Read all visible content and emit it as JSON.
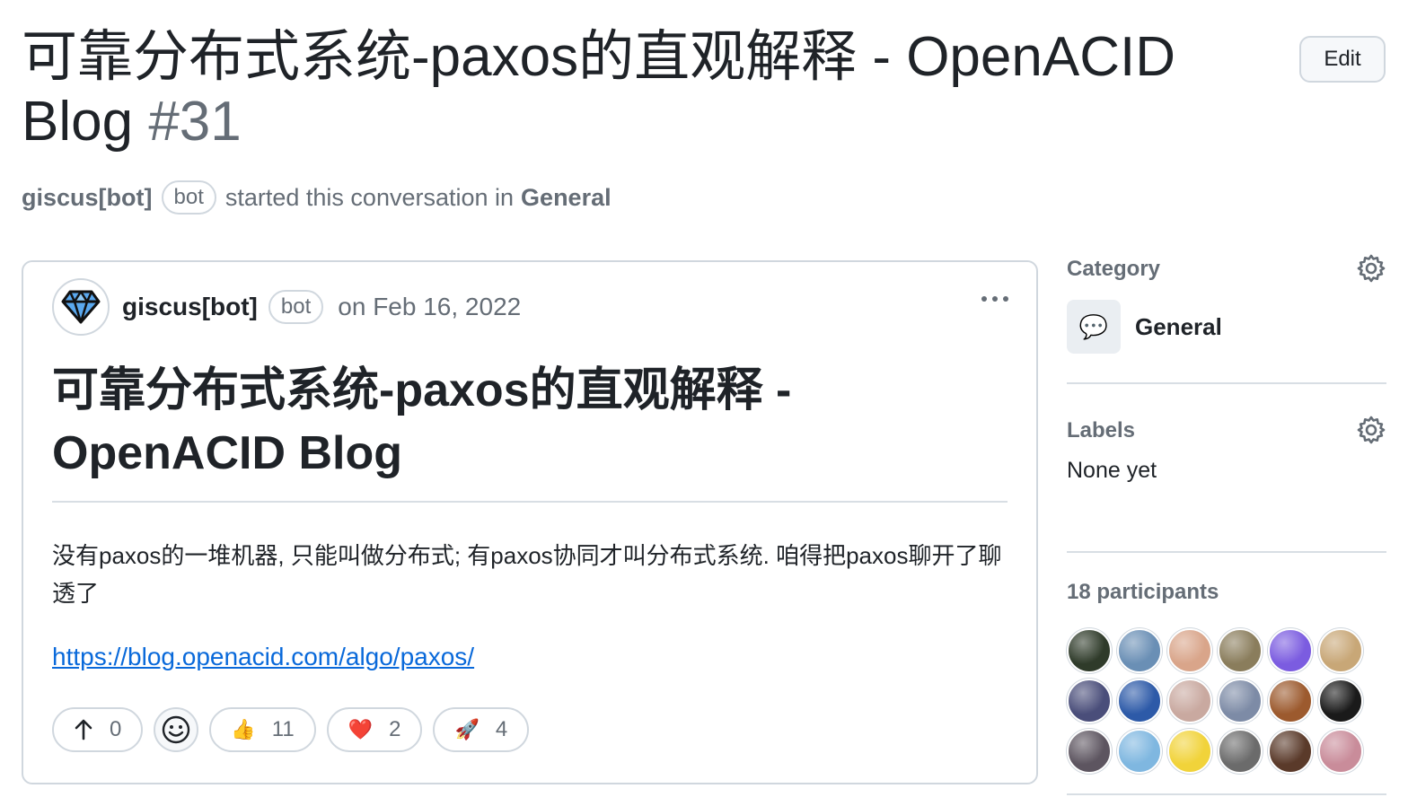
{
  "header": {
    "title": "可靠分布式系统-paxos的直观解释 - OpenACID Blog",
    "number": "#31",
    "edit_label": "Edit"
  },
  "meta": {
    "author": "giscus[bot]",
    "badge": "bot",
    "text": "started this conversation in",
    "category": "General"
  },
  "post": {
    "author": "giscus[bot]",
    "badge": "bot",
    "date": "on Feb 16, 2022",
    "title": "可靠分布式系统-paxos的直观解释 - OpenACID Blog",
    "body": "没有paxos的一堆机器, 只能叫做分布式; 有paxos协同才叫分布式系统. 咱得把paxos聊开了聊透了",
    "link": "https://blog.openacid.com/algo/paxos/",
    "reactions": {
      "upvote": "0",
      "thumbs_up": "11",
      "heart": "2",
      "rocket": "4"
    }
  },
  "sidebar": {
    "category_heading": "Category",
    "category_name": "General",
    "category_icon": "💬",
    "labels_heading": "Labels",
    "labels_value": "None yet",
    "participants_heading": "18 participants",
    "participants": [
      {
        "name": "participant-1",
        "color": "#2f3b2a"
      },
      {
        "name": "participant-2",
        "color": "#6a8fb5"
      },
      {
        "name": "participant-3",
        "color": "#d9a58a"
      },
      {
        "name": "participant-4",
        "color": "#8a7d5c"
      },
      {
        "name": "participant-5",
        "color": "#7b5ce0"
      },
      {
        "name": "participant-6",
        "color": "#c8a777"
      },
      {
        "name": "participant-7",
        "color": "#4a4e7a"
      },
      {
        "name": "participant-8",
        "color": "#2d5aa8"
      },
      {
        "name": "participant-9",
        "color": "#c9a9a0"
      },
      {
        "name": "participant-10",
        "color": "#7d8ba6"
      },
      {
        "name": "participant-11",
        "color": "#9c5a2e"
      },
      {
        "name": "participant-12",
        "color": "#1a1a1a"
      },
      {
        "name": "participant-13",
        "color": "#5d5560"
      },
      {
        "name": "participant-14",
        "color": "#7fb7e0"
      },
      {
        "name": "participant-15",
        "color": "#f1d33a"
      },
      {
        "name": "participant-16",
        "color": "#6b6b6b"
      },
      {
        "name": "participant-17",
        "color": "#5a3a2a"
      },
      {
        "name": "participant-18",
        "color": "#c98c9a"
      }
    ]
  }
}
